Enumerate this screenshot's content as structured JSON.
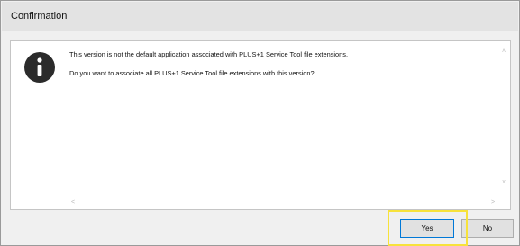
{
  "window": {
    "title": "Confirmation"
  },
  "message": {
    "icon": "info-icon",
    "line1": "This version is not the default application associated with PLUS+1 Service Tool file extensions.",
    "line2": "Do you want to associate all PLUS+1 Service Tool file extensions with this version?"
  },
  "scrollbars": {
    "up": "˄",
    "down": "˅",
    "left": "<",
    "right": ">"
  },
  "buttons": {
    "yes_label": "Yes",
    "no_label": "No"
  },
  "colors": {
    "highlight": "#f7e23b",
    "icon": "#2b2b2b",
    "default_button_border": "#0078d7"
  }
}
